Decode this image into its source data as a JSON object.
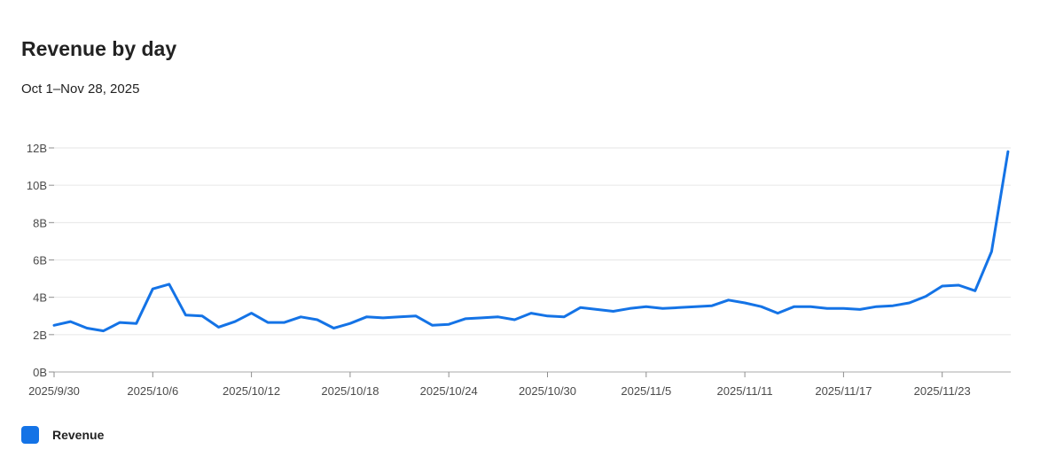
{
  "chart_data": {
    "type": "line",
    "title": "Revenue by day",
    "subtitle": "Oct 1–Nov 28, 2025",
    "xlabel": "",
    "ylabel": "",
    "x_start": "2025-09-30",
    "x_ticks": [
      "2025/9/30",
      "2025/10/6",
      "2025/10/12",
      "2025/10/18",
      "2025/10/24",
      "2025/10/30",
      "2025/11/5",
      "2025/11/11",
      "2025/11/17",
      "2025/11/23"
    ],
    "y_ticks": [
      "0B",
      "2B",
      "4B",
      "6B",
      "8B",
      "10B",
      "12B"
    ],
    "ylim": [
      0,
      12
    ],
    "y_unit": "B",
    "grid": true,
    "legend_position": "bottom-left",
    "series": [
      {
        "name": "Revenue",
        "color": "#1473e6",
        "values": [
          2.5,
          2.7,
          2.35,
          2.2,
          2.65,
          2.6,
          4.45,
          4.7,
          3.05,
          3.0,
          2.4,
          2.7,
          3.15,
          2.65,
          2.65,
          2.95,
          2.8,
          2.35,
          2.6,
          2.95,
          2.9,
          2.95,
          3.0,
          2.5,
          2.55,
          2.85,
          2.9,
          2.95,
          2.8,
          3.15,
          3.0,
          2.95,
          3.45,
          3.35,
          3.25,
          3.4,
          3.5,
          3.4,
          3.45,
          3.5,
          3.55,
          3.85,
          3.7,
          3.5,
          3.15,
          3.5,
          3.5,
          3.4,
          3.4,
          3.35,
          3.5,
          3.55,
          3.7,
          4.05,
          4.6,
          4.65,
          4.35,
          6.45,
          11.8
        ]
      }
    ]
  }
}
